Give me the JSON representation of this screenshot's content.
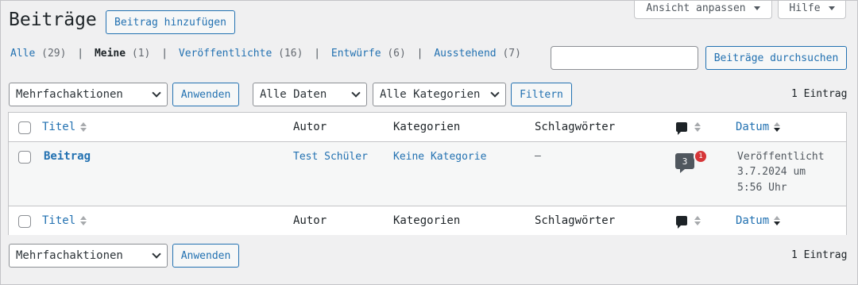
{
  "header": {
    "title": "Beiträge",
    "add_button": "Beitrag hinzufügen",
    "screen_options": "Ansicht anpassen",
    "help": "Hilfe"
  },
  "views": {
    "all_label": "Alle",
    "all_count": "(29)",
    "mine_label": "Meine",
    "mine_count": "(1)",
    "published_label": "Veröffentlichte",
    "published_count": "(16)",
    "drafts_label": "Entwürfe",
    "drafts_count": "(6)",
    "pending_label": "Ausstehend",
    "pending_count": "(7)",
    "separator": "|"
  },
  "search": {
    "value": "",
    "button": "Beiträge durchsuchen"
  },
  "tablenav_top": {
    "bulk_actions": "Mehrfachaktionen",
    "apply": "Anwenden",
    "dates": "Alle Daten",
    "categories": "Alle Kategorien",
    "filter": "Filtern",
    "count": "1 Eintrag"
  },
  "columns": {
    "title": "Titel",
    "author": "Autor",
    "categories": "Kategorien",
    "tags": "Schlagwörter",
    "date": "Datum"
  },
  "rows": [
    {
      "title": "Beitrag",
      "author": "Test Schüler",
      "categories": "Keine Kategorie",
      "tags": "—",
      "comments": "3",
      "pending_comments": "1",
      "date_status": "Veröffentlicht",
      "date_line": "3.7.2024 um",
      "date_time": "5:56 Uhr"
    }
  ],
  "tablenav_bottom": {
    "bulk_actions": "Mehrfachaktionen",
    "apply": "Anwenden",
    "count": "1 Eintrag"
  },
  "colors": {
    "link": "#2271b1",
    "badge": "#d63638",
    "border": "#c3c4c7"
  }
}
